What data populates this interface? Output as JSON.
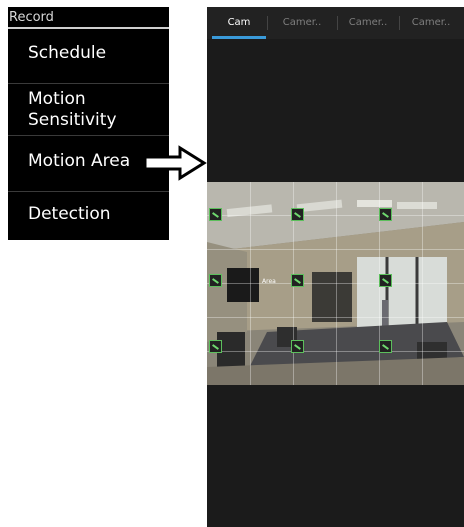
{
  "menu": {
    "header": "Record",
    "items": [
      {
        "label_lines": [
          "Schedule"
        ]
      },
      {
        "label_lines": [
          "Motion",
          "Sensitivity"
        ]
      },
      {
        "label_lines": [
          "Motion Area"
        ]
      },
      {
        "label_lines": [
          "Detection"
        ]
      }
    ]
  },
  "tabs": [
    "Cam",
    "Camer..",
    "Camer..",
    "Camer.."
  ],
  "video": {
    "overlay_label": "Area",
    "icons": {
      "motion_marker": "motion-area-marker-icon",
      "arrow": "right-arrow-icon"
    }
  },
  "colors": {
    "accent": "#3a9ad9",
    "marker": "#5cbf5c"
  }
}
